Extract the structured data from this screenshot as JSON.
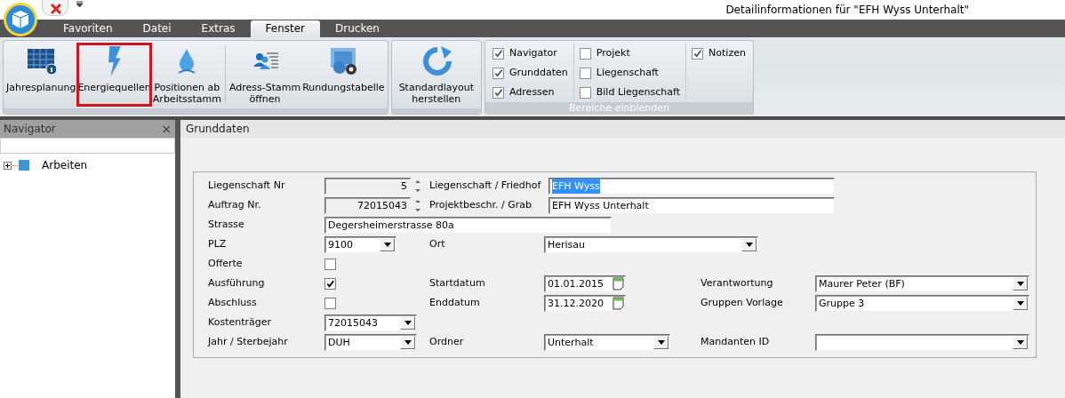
{
  "window": {
    "title": "Detailinformationen für \"EFH Wyss Unterhalt\""
  },
  "tabs": [
    {
      "label": "Favoriten",
      "selected": false
    },
    {
      "label": "Datei",
      "selected": false
    },
    {
      "label": "Extras",
      "selected": false
    },
    {
      "label": "Fenster",
      "selected": true
    },
    {
      "label": "Drucken",
      "selected": false
    }
  ],
  "ribbon": {
    "groups": [
      {
        "items": [
          {
            "kind": "button",
            "label": "Jahresplanung",
            "highlighted": false
          },
          {
            "kind": "button",
            "label": "Energiequellen",
            "highlighted": true
          },
          {
            "kind": "button",
            "label": "Positionen ab\nArbeitsstamm",
            "highlighted": false
          },
          {
            "kind": "separator"
          },
          {
            "kind": "button",
            "label": "Adress-Stamm\nöffnen",
            "highlighted": false
          },
          {
            "kind": "button",
            "label": "Rundungstabelle",
            "highlighted": false
          }
        ]
      },
      {
        "items": [
          {
            "kind": "button",
            "label": "Standardlayout\nherstellen",
            "highlighted": false
          }
        ]
      },
      {
        "title": "Bereiche einblenden",
        "columns": [
          [
            {
              "label": "Navigator",
              "checked": true
            },
            {
              "label": "Grunddaten",
              "checked": true
            },
            {
              "label": "Adressen",
              "checked": true
            }
          ],
          [
            {
              "label": "Projekt",
              "checked": false
            },
            {
              "label": "Liegenschaft",
              "checked": false
            },
            {
              "label": "Bild Liegenschaft",
              "checked": false
            }
          ],
          [
            {
              "label": "Notizen",
              "checked": true
            }
          ]
        ]
      }
    ]
  },
  "navigator": {
    "title": "Navigator",
    "close": "×",
    "tree": [
      {
        "label": "Arbeiten",
        "expanded": false
      }
    ]
  },
  "main": {
    "title": "Grunddaten",
    "rows": [
      [
        {
          "label": "Liegenschaft Nr",
          "kind": "spin",
          "value": "5"
        },
        {
          "label": "Liegenschaft / Friedhof",
          "kind": "text",
          "value": "EFH Wyss",
          "selected": true
        }
      ],
      [
        {
          "label": "Auftrag Nr.",
          "kind": "spin",
          "value": "72015043"
        },
        {
          "label": "Projektbeschr. / Grab",
          "kind": "text",
          "value": "EFH Wyss Unterhalt",
          "selected": false
        }
      ],
      [
        {
          "label": "Strasse",
          "kind": "text",
          "value": "Degersheimerstrasse 80a",
          "selected": false
        }
      ],
      [
        {
          "label": "PLZ",
          "kind": "combo",
          "value": "9100"
        },
        {
          "label": "Ort",
          "kind": "combo",
          "value": "Herisau"
        }
      ],
      [
        {
          "label": "Offerte",
          "kind": "checkbox",
          "checked": false
        }
      ],
      [
        {
          "label": "Ausführung",
          "kind": "checkbox",
          "checked": true
        },
        {
          "label": "Startdatum",
          "kind": "date",
          "value": "01.01.2015"
        },
        {
          "label": "Verantwortung",
          "kind": "combo",
          "value": "Maurer Peter (BF)"
        }
      ],
      [
        {
          "label": "Abschluss",
          "kind": "checkbox",
          "checked": false
        },
        {
          "label": "Enddatum",
          "kind": "date",
          "value": "31.12.2020"
        },
        {
          "label": "Gruppen Vorlage",
          "kind": "combo",
          "value": "Gruppe 3"
        }
      ],
      [
        {
          "label": "Kostenträger",
          "kind": "combo",
          "value": "72015043"
        }
      ],
      [
        {
          "label": "Jahr / Sterbejahr",
          "kind": "combo",
          "value": "DUH"
        },
        {
          "label": "Ordner",
          "kind": "combo",
          "value": "Unterhalt"
        },
        {
          "label": "Mandanten ID",
          "kind": "combo"
        }
      ]
    ]
  }
}
